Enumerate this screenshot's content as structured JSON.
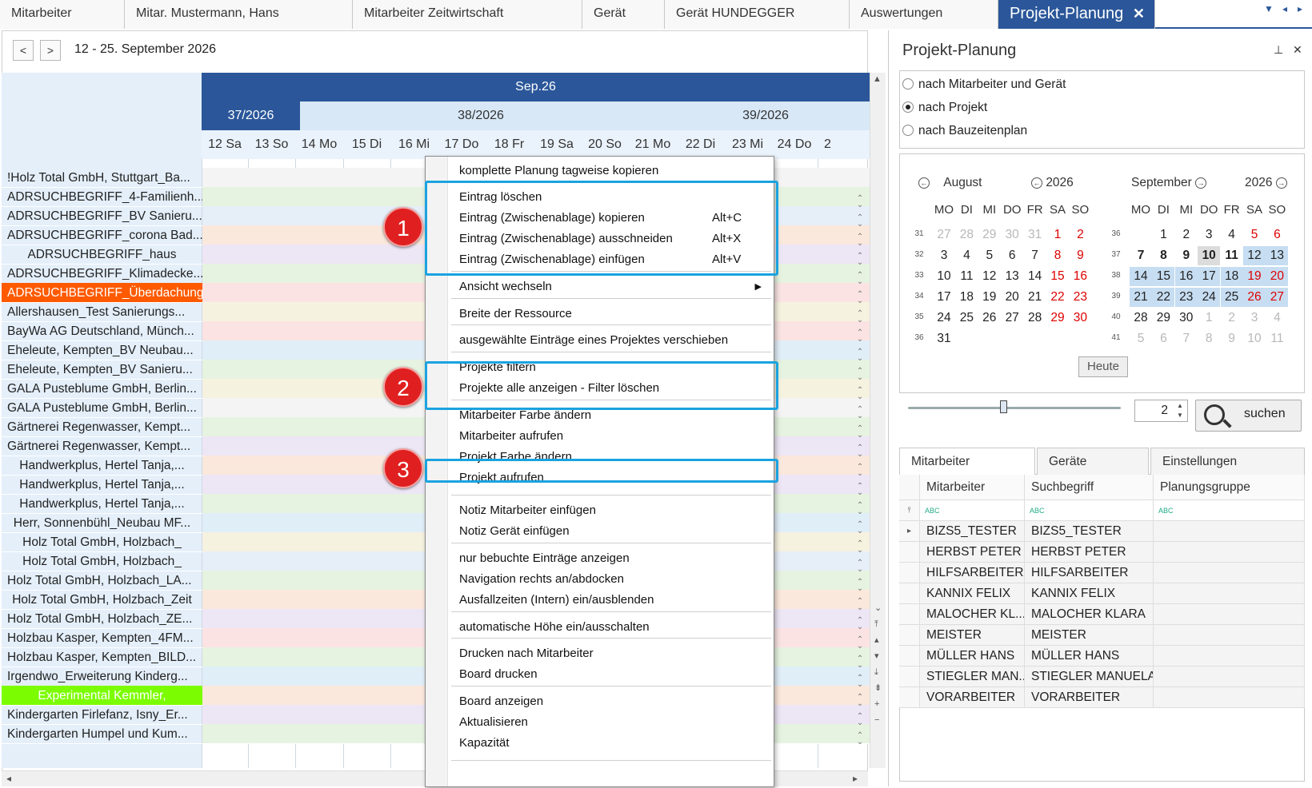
{
  "tabs": [
    {
      "label": "Mitarbeiter"
    },
    {
      "label": "Mitar. Mustermann, Hans"
    },
    {
      "label": "Mitarbeiter Zeitwirtschaft"
    },
    {
      "label": "Gerät"
    },
    {
      "label": "Gerät HUNDEGGER"
    },
    {
      "label": "Auswertungen"
    },
    {
      "label": "Projekt-Planung",
      "active": true
    }
  ],
  "toolbar": {
    "date_range": "12 - 25. September 2026",
    "prev": "<",
    "next": ">"
  },
  "schedule": {
    "month": "Sep.26",
    "weeks": [
      "37/2026",
      "38/2026",
      "39/2026"
    ],
    "days": [
      "12 Sa",
      "13 So",
      "14 Mo",
      "15 Di",
      "16 Mi",
      "17 Do",
      "18 Fr",
      "19 Sa",
      "20 So",
      "21 Mo",
      "22 Di",
      "23 Mi",
      "24 Do",
      "2"
    ],
    "rows": [
      {
        "label": "!Holz Total GmbH, Stuttgart_Ba...",
        "bg": "#f4f4f4",
        "color": ""
      },
      {
        "label": "ADRSUCHBEGRIFF_4-Familienh...",
        "bg": "#e6f3e0",
        "color": ""
      },
      {
        "label": "ADRSUCHBEGRIFF_BV Sanieru...",
        "bg": "#e6eef8",
        "color": ""
      },
      {
        "label": "ADRSUCHBEGRIFF_corona Bad...",
        "bg": "#fbe8dc",
        "color": ""
      },
      {
        "label": "ADRSUCHBEGRIFF_haus",
        "bg": "#ede6f5",
        "color": "",
        "center": true
      },
      {
        "label": "ADRSUCHBEGRIFF_Klimadecke...",
        "bg": "#e6f3e0",
        "color": ""
      },
      {
        "label": "ADRSUCHBEGRIFF_Überdachung",
        "bg": "#fbe3e3",
        "color": "#ff5a00",
        "fg": "#fff"
      },
      {
        "label": "Allershausen_Test Sanierungs...",
        "bg": "#f6f2e0",
        "color": ""
      },
      {
        "label": "BayWa AG Deutschland, Münch...",
        "bg": "#fbe3e3",
        "color": ""
      },
      {
        "label": "Eheleute, Kempten_BV Neubau...",
        "bg": "#e0eef8",
        "color": ""
      },
      {
        "label": "Eheleute, Kempten_BV Sanieru...",
        "bg": "#e6f3e0",
        "color": ""
      },
      {
        "label": "GALA Pusteblume GmbH, Berlin...",
        "bg": "#f6f2e0",
        "color": ""
      },
      {
        "label": "GALA Pusteblume GmbH, Berlin...",
        "bg": "#f4f4f4",
        "color": ""
      },
      {
        "label": "Gärtnerei Regenwasser, Kempt...",
        "bg": "#e6f3e0",
        "color": ""
      },
      {
        "label": "Gärtnerei Regenwasser, Kempt...",
        "bg": "#ede6f5",
        "color": ""
      },
      {
        "label": "Handwerkplus, Hertel Tanja,...",
        "bg": "#fbe8dc",
        "color": "",
        "center": true
      },
      {
        "label": "Handwerkplus, Hertel Tanja,...",
        "bg": "#ede6f5",
        "color": "",
        "center": true
      },
      {
        "label": "Handwerkplus, Hertel Tanja,...",
        "bg": "#e6f3e0",
        "color": "",
        "center": true
      },
      {
        "label": "Herr, Sonnenbühl_Neubau MF...",
        "bg": "#e0eef8",
        "color": "",
        "center": true
      },
      {
        "label": "Holz Total GmbH, Holzbach_",
        "bg": "#f6f2e0",
        "color": "",
        "center": true
      },
      {
        "label": "Holz Total GmbH, Holzbach_",
        "bg": "#e6eef8",
        "color": "",
        "center": true
      },
      {
        "label": "Holz Total GmbH, Holzbach_LA...",
        "bg": "#e6f3e0",
        "color": ""
      },
      {
        "label": "Holz Total GmbH, Holzbach_Zeit",
        "bg": "#fbe8dc",
        "color": "",
        "center": true
      },
      {
        "label": "Holz Total GmbH, Holzbach_ZE...",
        "bg": "#ede6f5",
        "color": ""
      },
      {
        "label": "Holzbau Kasper, Kempten_4FM...",
        "bg": "#fbe3e3",
        "color": ""
      },
      {
        "label": "Holzbau Kasper, Kempten_BILD...",
        "bg": "#e6f3e0",
        "color": ""
      },
      {
        "label": "Irgendwo_Erweiterung Kinderg...",
        "bg": "#e0eef8",
        "color": ""
      },
      {
        "label": "Experimental Kemmler,",
        "bg": "#fbe8dc",
        "color": "#7cfc00",
        "fg": "#fff",
        "center": true
      },
      {
        "label": "Kindergarten Firlefanz, Isny_Er...",
        "bg": "#ede6f5",
        "color": ""
      },
      {
        "label": "Kindergarten Humpel und Kum...",
        "bg": "#e6f3e0",
        "color": ""
      }
    ]
  },
  "context_menu": {
    "items": [
      {
        "label": "komplette Planung tagweise kopieren"
      },
      {
        "label": "Eintrag löschen"
      },
      {
        "label": "Eintrag (Zwischenablage) kopieren",
        "shortcut": "Alt+C"
      },
      {
        "label": "Eintrag (Zwischenablage) ausschneiden",
        "shortcut": "Alt+X"
      },
      {
        "label": "Eintrag (Zwischenablage) einfügen",
        "shortcut": "Alt+V"
      },
      {
        "label": "Ansicht wechseln",
        "submenu": true
      },
      {
        "label": "Breite der Ressource"
      },
      {
        "label": "ausgewählte  Einträge eines Projektes verschieben"
      },
      {
        "label": "Projekte filtern"
      },
      {
        "label": "Projekte alle anzeigen - Filter löschen"
      },
      {
        "label": "Mitarbeiter Farbe ändern"
      },
      {
        "label": "Mitarbeiter aufrufen"
      },
      {
        "label": "Projekt Farbe ändern"
      },
      {
        "label": "Projekt aufrufen"
      },
      {
        "label": "Notiz Mitarbeiter einfügen"
      },
      {
        "label": "Notiz Gerät einfügen"
      },
      {
        "label": "nur bebuchte Einträge anzeigen"
      },
      {
        "label": "Navigation rechts an/abdocken"
      },
      {
        "label": "Ausfallzeiten (Intern) ein/ausblenden"
      },
      {
        "label": "automatische Höhe ein/ausschalten"
      },
      {
        "label": "Drucken nach Mitarbeiter"
      },
      {
        "label": "Board drucken"
      },
      {
        "label": "Board anzeigen"
      },
      {
        "label": "Aktualisieren"
      },
      {
        "label": "Kapazität"
      }
    ],
    "submenu_arrow": "▶",
    "badges": [
      "1",
      "2",
      "3"
    ],
    "highlight_color": "#1aa3e0",
    "badge_color": "#e02020"
  },
  "right_panel": {
    "title": "Projekt-Planung",
    "pin_icon": "📌",
    "close_icon": "✕",
    "radios": [
      {
        "label": "nach Mitarbeiter und Gerät",
        "checked": false
      },
      {
        "label": "nach Projekt",
        "checked": true
      },
      {
        "label": "nach Bauzeitenplan",
        "checked": false
      }
    ],
    "calendar": {
      "left": {
        "month": "August",
        "year": "2026"
      },
      "right": {
        "month": "September",
        "year": "2026"
      },
      "dow": [
        "MO",
        "DI",
        "MI",
        "DO",
        "FR",
        "SA",
        "SO"
      ],
      "left_weeks": [
        "31",
        "32",
        "33",
        "34",
        "35",
        "36"
      ],
      "right_weeks": [
        "36",
        "37",
        "38",
        "39",
        "40",
        "41"
      ],
      "left_days": [
        [
          "27",
          "28",
          "29",
          "30",
          "31",
          "1",
          "2"
        ],
        [
          "3",
          "4",
          "5",
          "6",
          "7",
          "8",
          "9"
        ],
        [
          "10",
          "11",
          "12",
          "13",
          "14",
          "15",
          "16"
        ],
        [
          "17",
          "18",
          "19",
          "20",
          "21",
          "22",
          "23"
        ],
        [
          "24",
          "25",
          "26",
          "27",
          "28",
          "29",
          "30"
        ],
        [
          "31",
          "",
          "",
          "",
          "",
          "",
          ""
        ]
      ],
      "right_days": [
        [
          "",
          "1",
          "2",
          "3",
          "4",
          "5",
          "6"
        ],
        [
          "7",
          "8",
          "9",
          "10",
          "11",
          "12",
          "13"
        ],
        [
          "14",
          "15",
          "16",
          "17",
          "18",
          "19",
          "20"
        ],
        [
          "21",
          "22",
          "23",
          "24",
          "25",
          "26",
          "27"
        ],
        [
          "28",
          "29",
          "30",
          "1",
          "2",
          "3",
          "4"
        ],
        [
          "5",
          "6",
          "7",
          "8",
          "9",
          "10",
          "11"
        ]
      ],
      "today_label": "Heute"
    },
    "zoom_value": "2",
    "search_label": "suchen",
    "grid_tabs": [
      "Mitarbeiter",
      "Geräte",
      "Einstellungen"
    ],
    "grid_columns": [
      "Mitarbeiter",
      "Suchbegriff",
      "Planungsgruppe"
    ],
    "filter_icon": "ABC",
    "grid_rows": [
      [
        "BIZS5_TESTER",
        "BIZS5_TESTER",
        ""
      ],
      [
        "HERBST PETER",
        "HERBST PETER",
        ""
      ],
      [
        "HILFSARBEITER",
        "HILFSARBEITER",
        ""
      ],
      [
        "KANNIX FELIX",
        "KANNIX FELIX",
        ""
      ],
      [
        "MALOCHER KL...",
        "MALOCHER KLARA",
        ""
      ],
      [
        "MEISTER",
        "MEISTER",
        ""
      ],
      [
        "MÜLLER HANS",
        "MÜLLER HANS",
        ""
      ],
      [
        "STIEGLER MAN...",
        "STIEGLER MANUELA",
        ""
      ],
      [
        "VORARBEITER",
        "VORARBEITER",
        ""
      ]
    ]
  }
}
